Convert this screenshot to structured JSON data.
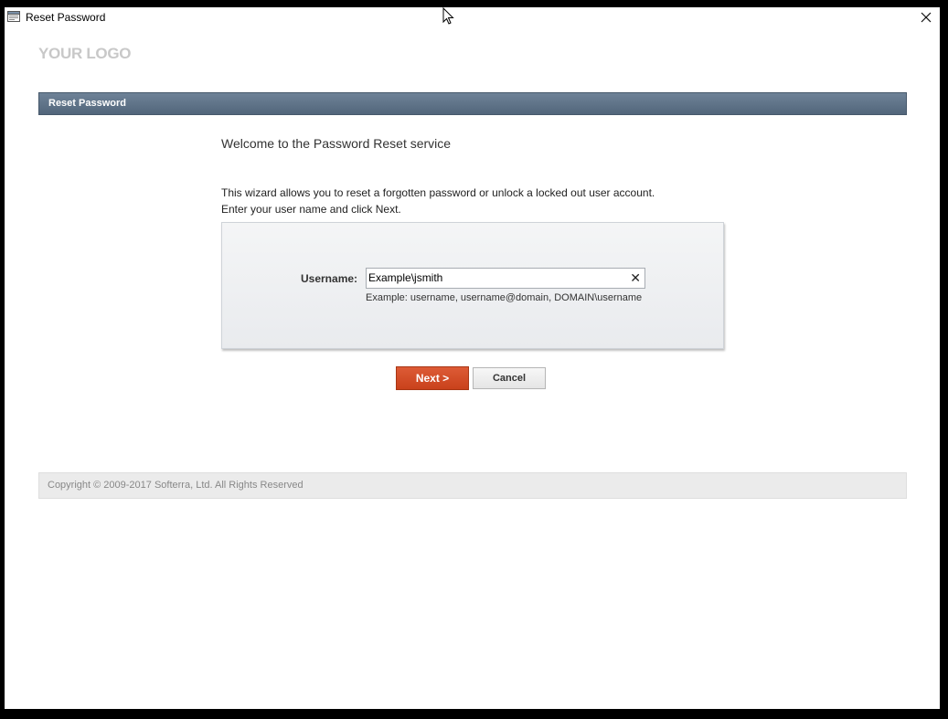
{
  "window": {
    "title": "Reset Password",
    "close_icon": "close-icon"
  },
  "logo": {
    "text": "YOUR LOGO"
  },
  "section": {
    "title": "Reset Password"
  },
  "main": {
    "welcome": "Welcome to the Password Reset service",
    "desc_line1": "This wizard allows you to reset a forgotten password or unlock a locked out user account.",
    "desc_line2": "Enter your user name and click Next."
  },
  "form": {
    "username_label": "Username:",
    "username_value": "Example\\jsmith",
    "clear_icon": "clear-icon",
    "example_text": "Example: username, username@domain, DOMAIN\\username"
  },
  "buttons": {
    "next_label": "Next >",
    "cancel_label": "Cancel"
  },
  "footer": {
    "copyright": "Copyright © 2009-2017 Softerra, Ltd. All Rights Reserved"
  },
  "colors": {
    "section_bar": "#5f7389",
    "next_button": "#d44d27",
    "logo": "#c8c8c8"
  }
}
